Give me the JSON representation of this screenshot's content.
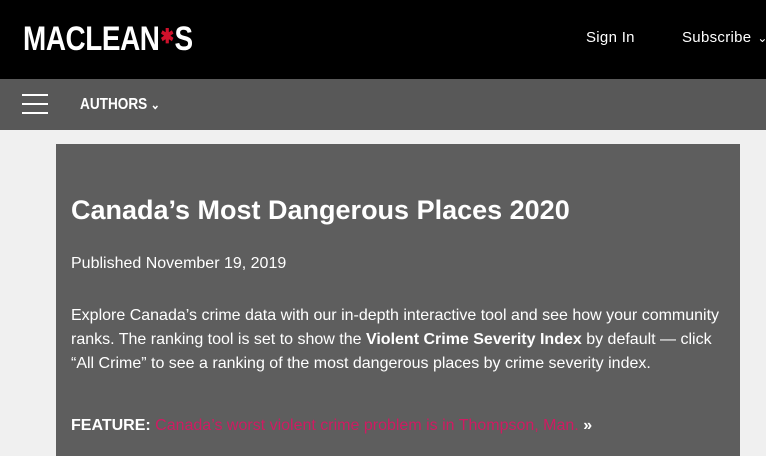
{
  "header": {
    "logo_text_1": "MACLEAN",
    "logo_leaf": "✱",
    "logo_text_2": "S",
    "sign_in_label": "Sign In",
    "subscribe_label": "Subscribe",
    "accent_color": "#d0112b"
  },
  "nav": {
    "menu_icon": "hamburger-menu-icon",
    "authors_label": "AUTHORS",
    "chevron": "⌄"
  },
  "article": {
    "title": "Canada’s Most Dangerous Places 2020",
    "published": "Published November 19, 2019",
    "desc_part1": "Explore Canada’s crime data with our in-depth interactive tool and see how your community ranks. The ranking tool is set to show the ",
    "desc_bold": "Violent Crime Severity Index",
    "desc_part2": " by default — click “All Crime” to see a ranking of the most dangerous places by crime severity index.",
    "feature_label": "FEATURE:",
    "feature_link": "Canada’s worst violent crime problem is in Thompson, Man.",
    "feature_suffix": " »",
    "link_color": "#cf1b62"
  }
}
